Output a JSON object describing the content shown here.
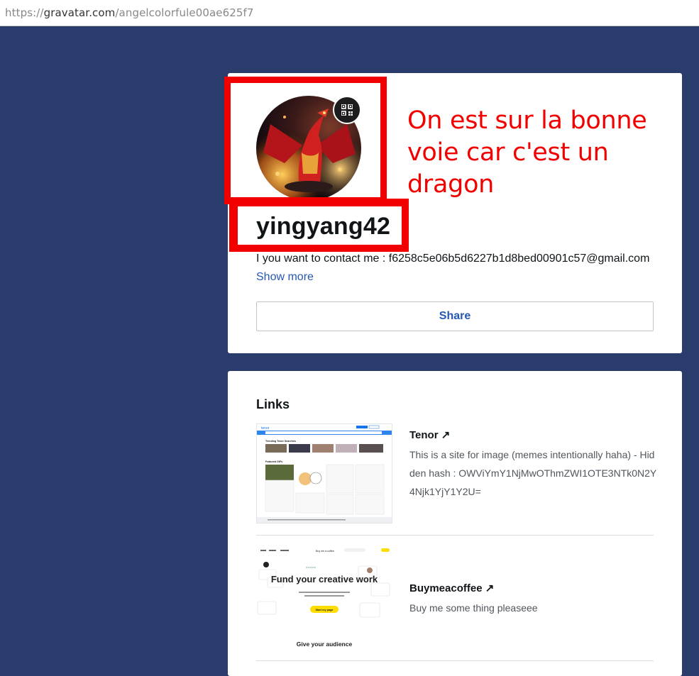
{
  "browser": {
    "url_prefix": "https://",
    "url_host": "gravatar.com",
    "url_path": "/angelcolorfule00ae625f7"
  },
  "profile": {
    "username": "yingyang42",
    "bio": "I you want to contact me : f6258c5e06b5d6227b1d8bed00901c57@gmail.com",
    "show_more": "Show more",
    "share_label": "Share"
  },
  "annotation": {
    "line1": "On est sur la bonne",
    "line2": "voie car c'est un dragon"
  },
  "links": {
    "title": "Links",
    "items": [
      {
        "title": "Tenor ↗",
        "description": "This is a site for image (memes intentionally haha) - Hidden hash : OWViYmY1NjMwOThmZWI1OTE3NTk0N2Y4Njk1YjY1Y2U="
      },
      {
        "title": "Buymeacoffee ↗",
        "description": "Buy me some thing pleaseee"
      }
    ]
  },
  "thumbnails": {
    "buymeacoffee_heading": "Fund your creative work",
    "buymeacoffee_button": "Start my page",
    "buymeacoffee_footer": "Give your audience",
    "buymeacoffee_logo": "Buy me a coffee",
    "tenor_logo": "tenor",
    "tenor_trending": "Trending Tenor Searches",
    "tenor_featured": "Featured GIFs"
  },
  "colors": {
    "background": "#2a3c6b",
    "annotation_red": "#f20000",
    "link_blue": "#2558b3"
  }
}
